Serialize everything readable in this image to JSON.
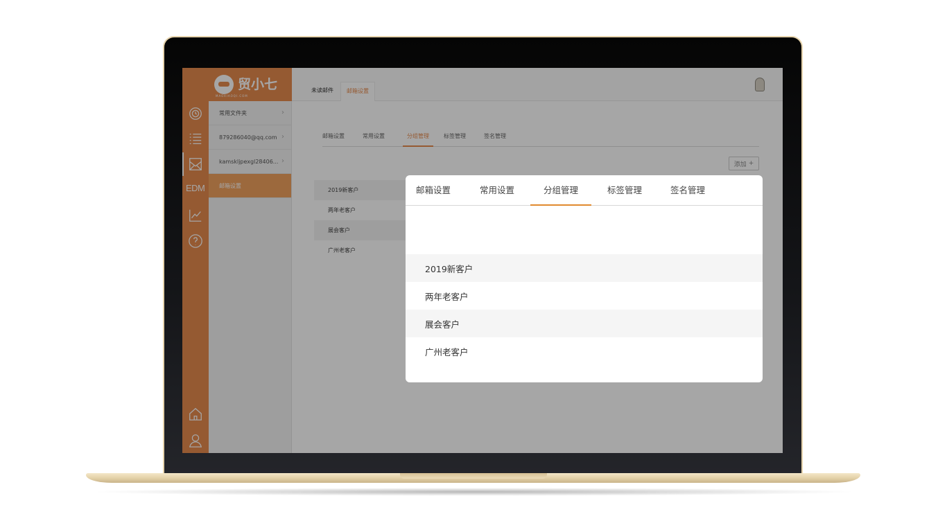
{
  "app": {
    "logo_text": "贸小七",
    "logo_sub": "MAOXIAOQI.COM",
    "rail_edm_label": "EDM"
  },
  "folders": [
    {
      "label": "常用文件夹"
    },
    {
      "label": "879286040@qq.com"
    },
    {
      "label": "kamskljpexgl28406..."
    },
    {
      "label": "邮箱设置"
    }
  ],
  "topbar": {
    "unread_tab": "未读邮件",
    "settings_tab": "邮箱设置"
  },
  "background_page": {
    "tabs": [
      "邮箱设置",
      "常用设置",
      "分组管理",
      "标签管理",
      "签名管理"
    ],
    "active_tab": "分组管理",
    "add_button": "添加",
    "groups": [
      "2019新客户",
      "两年老客户",
      "展会客户",
      "广州老客户"
    ]
  },
  "modal": {
    "tabs": [
      "邮箱设置",
      "常用设置",
      "分组管理",
      "标签管理",
      "签名管理"
    ],
    "active_tab": "分组管理",
    "groups": [
      "2019新客户",
      "两年老客户",
      "展会客户",
      "广州老客户"
    ]
  },
  "colors": {
    "accent": "#e58a4d",
    "modal_tab_underline": "#e08a2e",
    "laptop_gold": "#e7d4ad"
  },
  "icons": [
    "clock-icon",
    "list-icon",
    "mail-icon",
    "chart-icon",
    "help-icon",
    "home-icon",
    "user-icon",
    "plus-icon",
    "chevron-right-icon"
  ]
}
